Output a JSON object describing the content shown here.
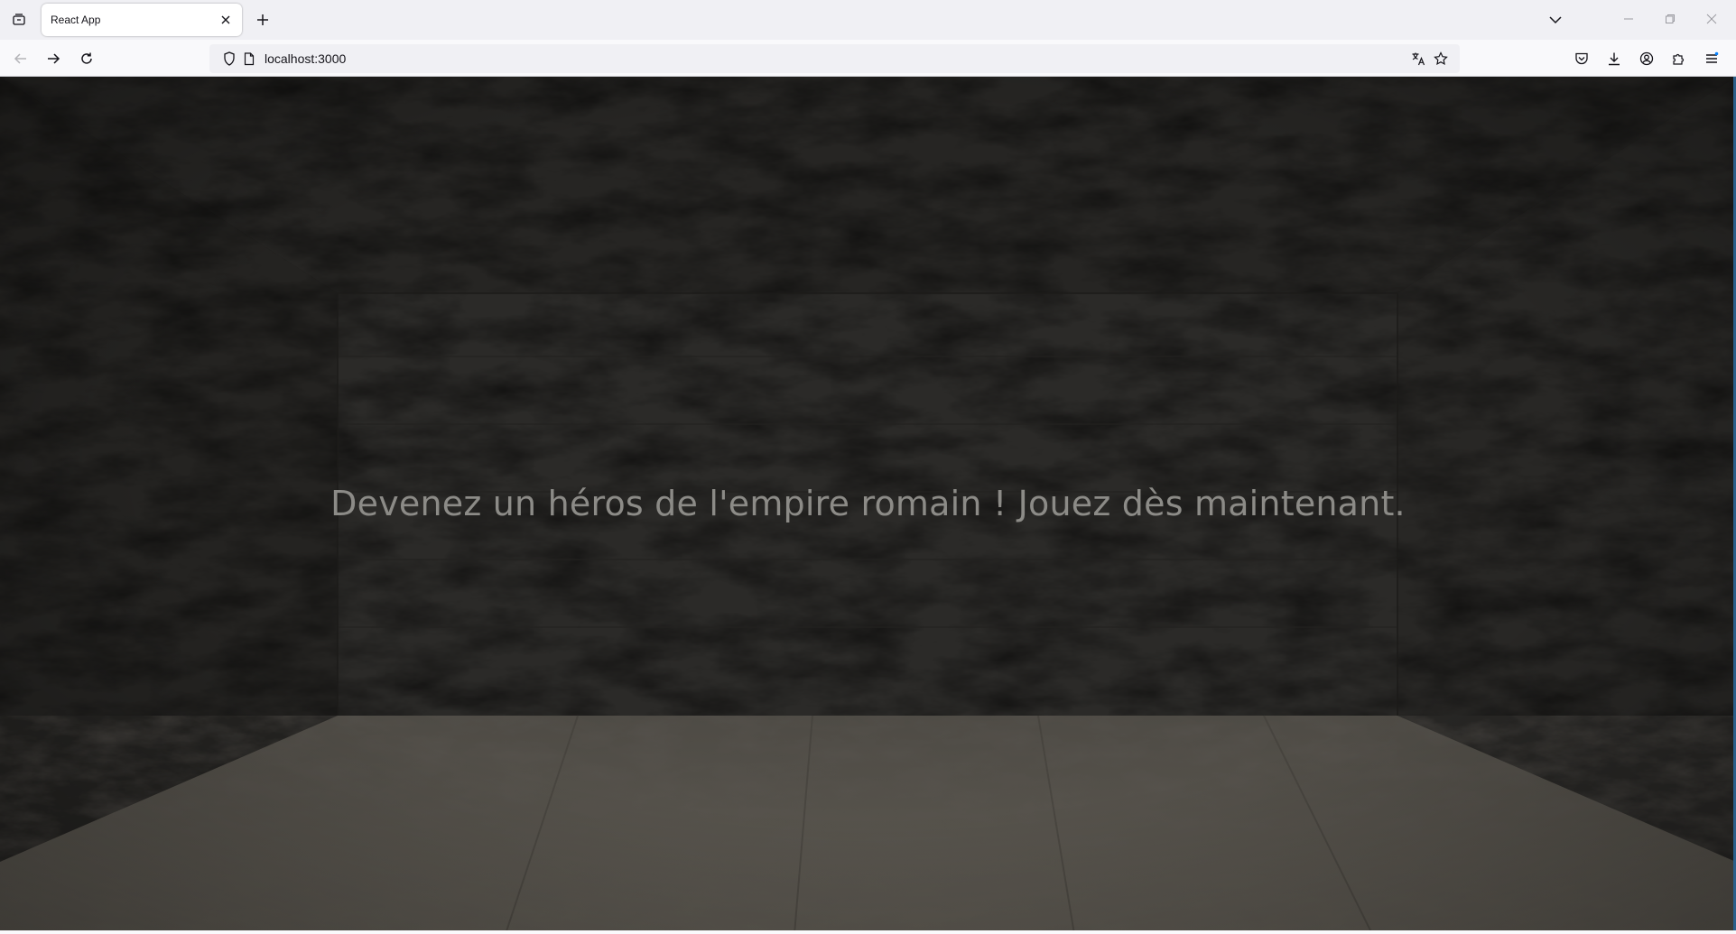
{
  "browser": {
    "tab": {
      "title": "React App"
    },
    "url": "localhost:3000",
    "icons": {
      "tab_list": "tab-list-icon",
      "tab_close": "close-icon",
      "new_tab": "plus-icon",
      "tab_overflow": "chevron-down-icon",
      "minimize": "minimize-icon",
      "restore": "restore-icon",
      "close_window": "close-icon",
      "back": "arrow-left-icon",
      "forward": "arrow-right-icon",
      "reload": "reload-icon",
      "tracking_protection": "shield-icon",
      "page_info": "page-icon",
      "translate": "translate-icon",
      "bookmark": "star-icon",
      "pocket": "pocket-icon",
      "downloads": "download-icon",
      "account": "account-icon",
      "extensions": "puzzle-icon",
      "menu": "hamburger-menu-icon"
    }
  },
  "page": {
    "hero_text": "Devenez un héros de l'empire romain ! Jouez dès maintenant.",
    "colors": {
      "background": "#1e1d1b",
      "wall": "#2a2927",
      "floor": "#5a5750",
      "text": "#8c8b87"
    }
  }
}
